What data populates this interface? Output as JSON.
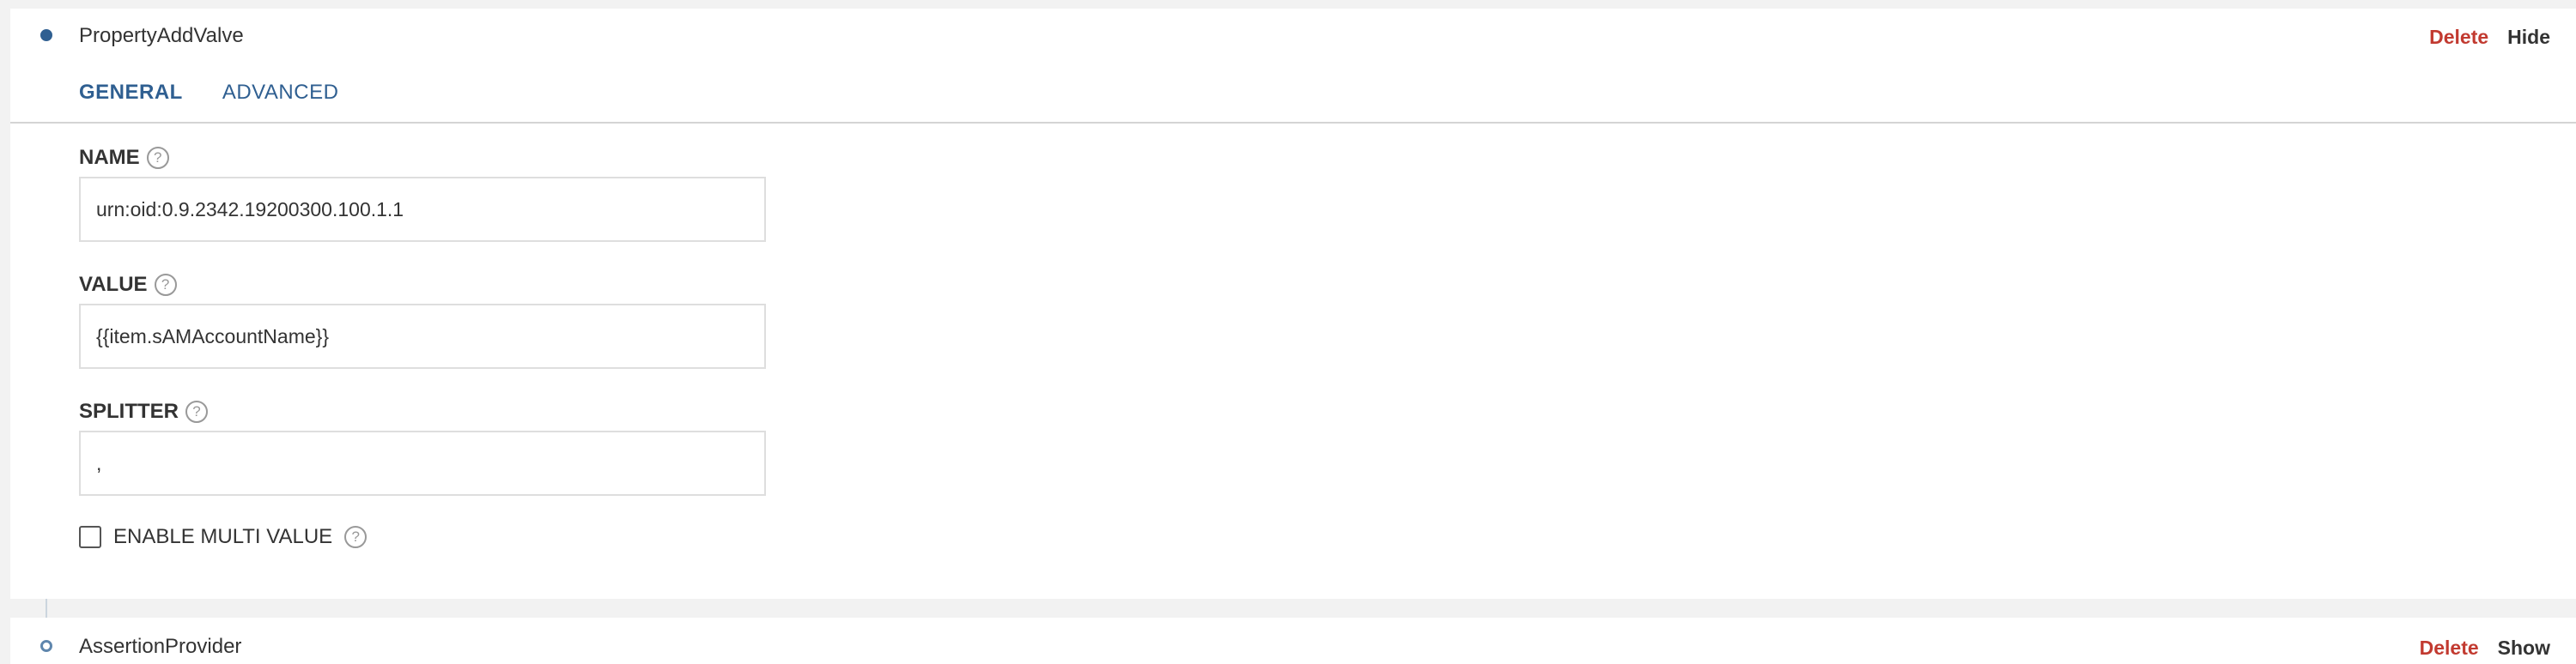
{
  "items": [
    {
      "title": "PropertyAddValve",
      "delete_label": "Delete",
      "toggle_label": "Hide",
      "tabs": [
        {
          "label": "GENERAL",
          "active": true
        },
        {
          "label": "ADVANCED",
          "active": false
        }
      ],
      "fields": {
        "name": {
          "label": "NAME",
          "value": "urn:oid:0.9.2342.19200300.100.1.1"
        },
        "value": {
          "label": "VALUE",
          "value": "{{item.sAMAccountName}}"
        },
        "splitter": {
          "label": "SPLITTER",
          "value": ","
        }
      },
      "checkbox": {
        "label": "ENABLE MULTI VALUE",
        "checked": false
      },
      "help_glyph": "?"
    },
    {
      "title": "AssertionProvider",
      "delete_label": "Delete",
      "toggle_label": "Show"
    }
  ],
  "colors": {
    "accent": "#2f5f91",
    "danger": "#c23a30",
    "background": "#f2f2f2"
  }
}
